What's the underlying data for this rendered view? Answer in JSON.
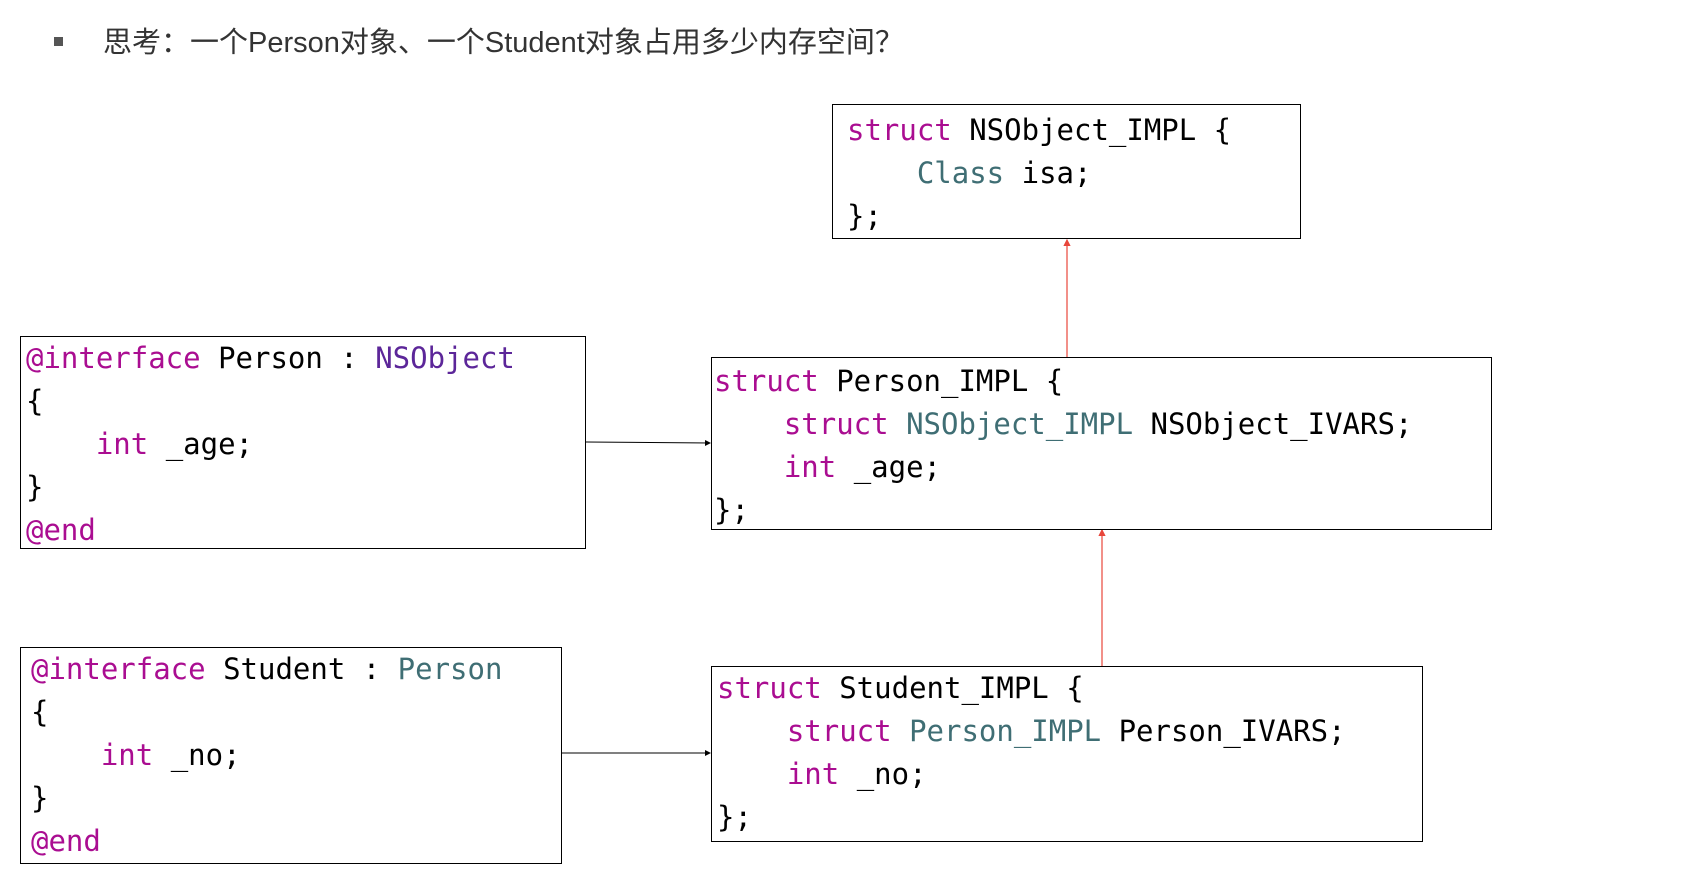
{
  "heading": {
    "text": "思考：一个Person对象、一个Student对象占用多少内存空间？"
  },
  "colors": {
    "keyword": "#aa0d91",
    "type": "#3f6e74",
    "nsobject": "#5c2699",
    "arrow_red": "#e8463b",
    "arrow_black": "#000000"
  },
  "person_interface": {
    "at_interface": "@interface",
    "name": " Person : ",
    "super": "NSObject",
    "open": "{",
    "ivar_kw": "int",
    "ivar_name": " _age;",
    "close": "}",
    "at_end": "@end"
  },
  "student_interface": {
    "at_interface": "@interface",
    "name": " Student : ",
    "super": "Person",
    "open": "{",
    "ivar_kw": "int",
    "ivar_name": " _no;",
    "close": "}",
    "at_end": "@end"
  },
  "nsobject_impl": {
    "kw": "struct",
    "name": " NSObject_IMPL {",
    "field_type": "Class",
    "field_name": " isa;",
    "close": "};"
  },
  "person_impl": {
    "kw": "struct",
    "name": " Person_IMPL {",
    "f1_kw": "struct",
    "f1_type": " NSObject_IMPL",
    "f1_name": " NSObject_IVARS;",
    "f2_kw": "int",
    "f2_name": " _age;",
    "close": "};"
  },
  "student_impl": {
    "kw": "struct",
    "name": " Student_IMPL {",
    "f1_kw": "struct",
    "f1_type": " Person_IMPL",
    "f1_name": " Person_IVARS;",
    "f2_kw": "int",
    "f2_name": " _no;",
    "close": "};"
  }
}
